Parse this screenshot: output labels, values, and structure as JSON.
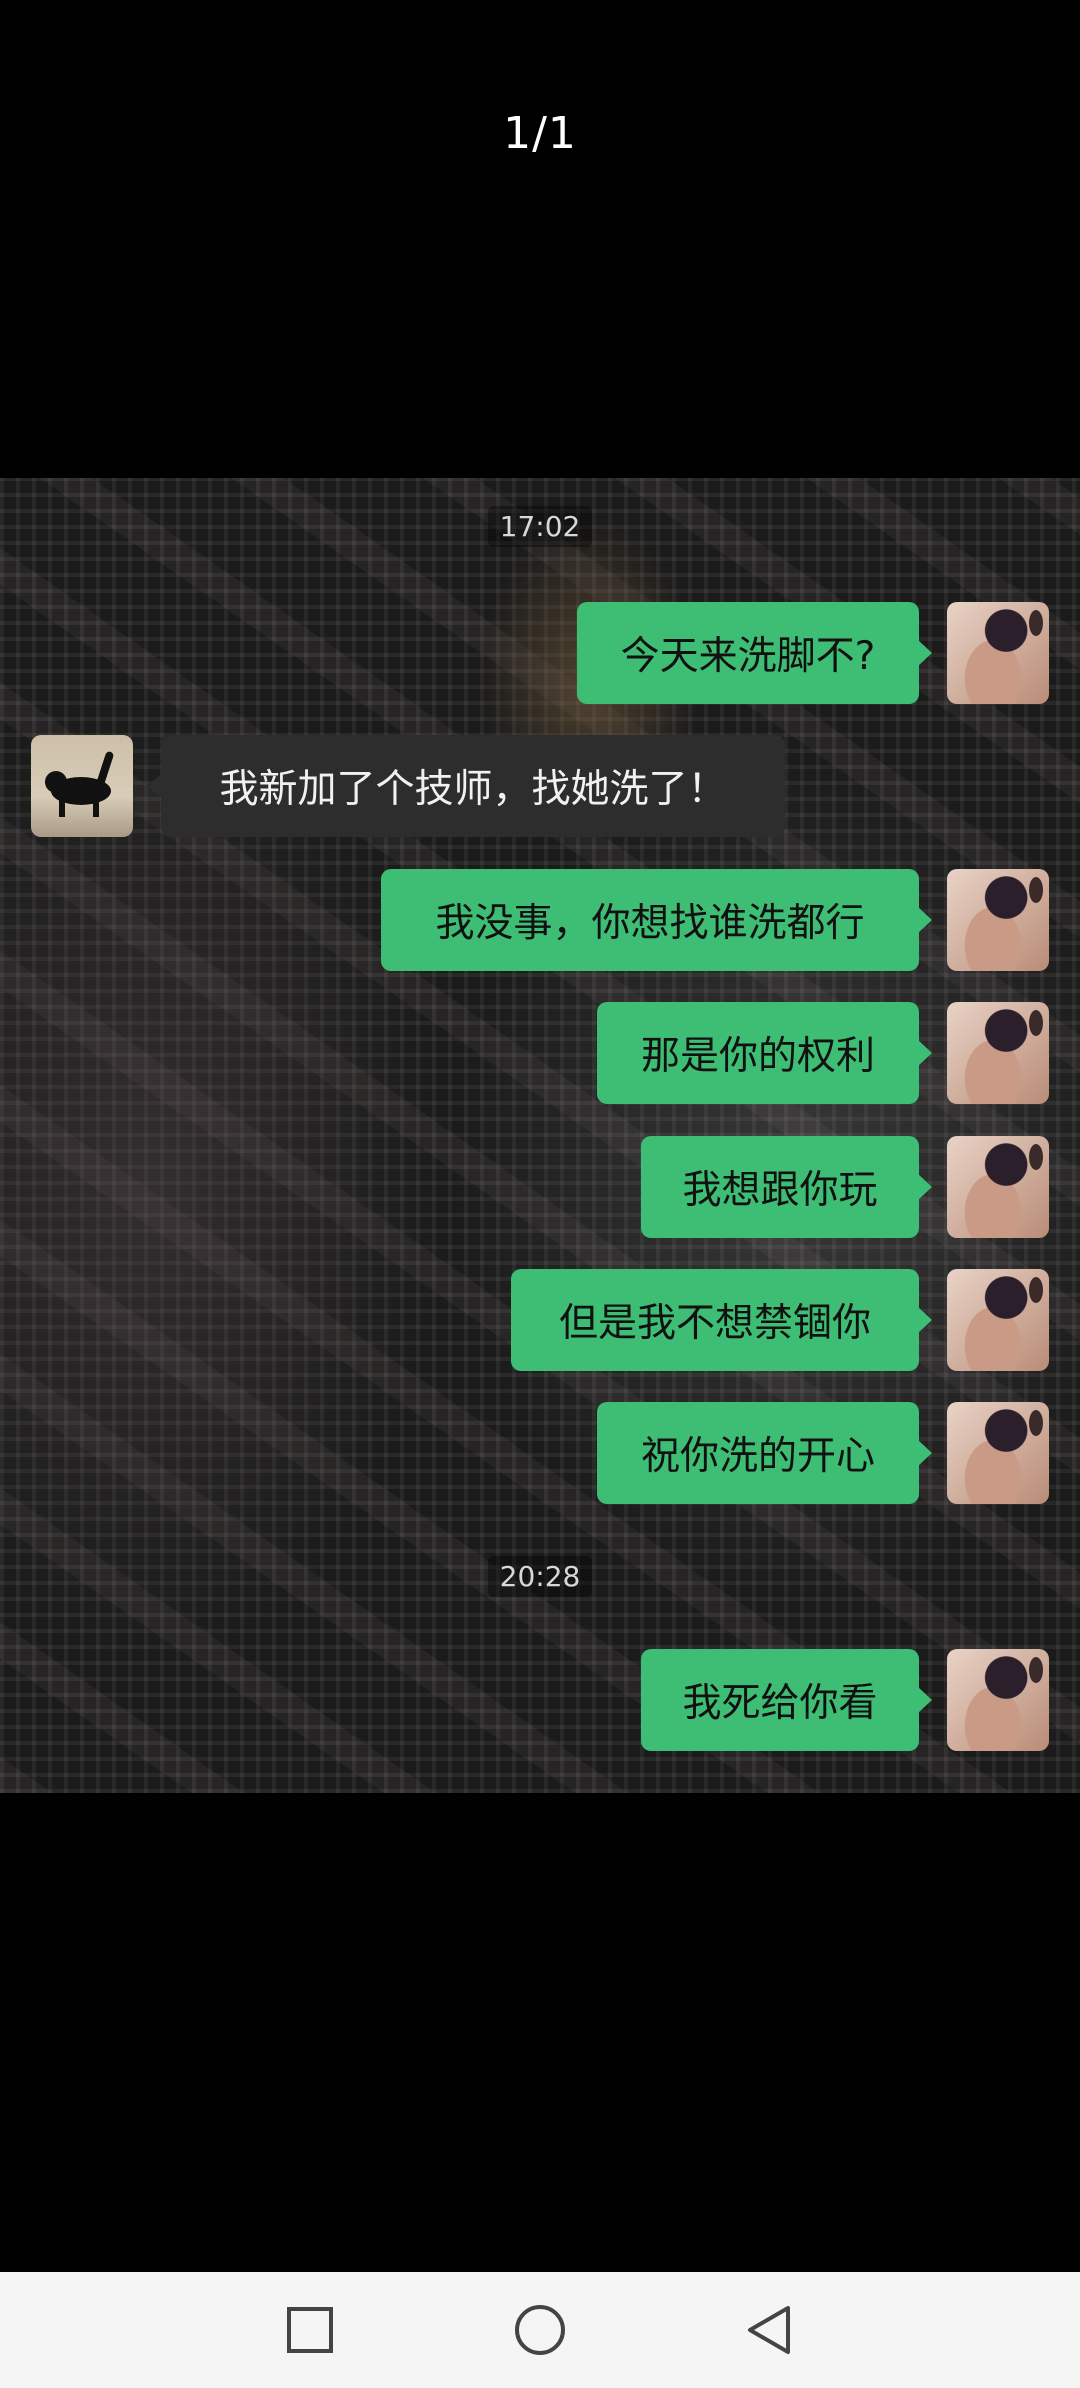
{
  "viewer": {
    "page_counter": "1/1"
  },
  "chat": {
    "timestamps": [
      "17:02",
      "20:28"
    ],
    "messages": [
      {
        "sender": "self",
        "text": "今天来洗脚不?"
      },
      {
        "sender": "other",
        "text": "我新加了个技师，找她洗了！"
      },
      {
        "sender": "self",
        "text": "我没事，你想找谁洗都行"
      },
      {
        "sender": "self",
        "text": "那是你的权利"
      },
      {
        "sender": "self",
        "text": "我想跟你玩"
      },
      {
        "sender": "self",
        "text": "但是我不想禁锢你"
      },
      {
        "sender": "self",
        "text": "祝你洗的开心"
      },
      {
        "sender": "self",
        "text": "我死给你看"
      }
    ]
  },
  "colors": {
    "self_bubble": "#3ebd74",
    "other_bubble": "#2d2d2d",
    "background": "#000000",
    "nav_bar": "#f5f5f5"
  },
  "nav": {
    "icons": [
      "square-recent-apps-icon",
      "circle-home-icon",
      "triangle-back-icon"
    ]
  }
}
